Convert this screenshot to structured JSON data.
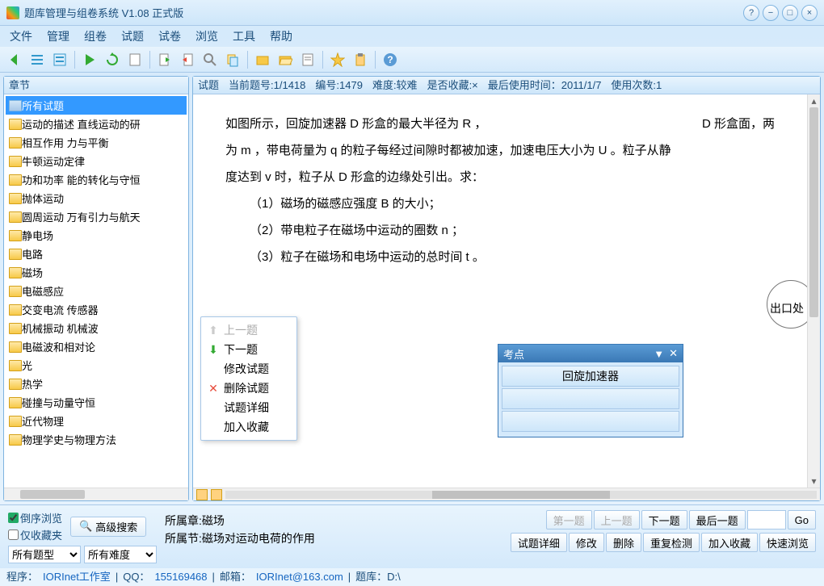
{
  "title": "题库管理与组卷系统 V1.08 正式版",
  "menu": [
    "文件",
    "管理",
    "组卷",
    "试题",
    "试卷",
    "浏览",
    "工具",
    "帮助"
  ],
  "sidebar": {
    "head": "章节",
    "items": [
      {
        "label": "所有试题",
        "root": true,
        "sel": true
      },
      {
        "label": "运动的描述 直线运动的研"
      },
      {
        "label": "相互作用 力与平衡"
      },
      {
        "label": "牛顿运动定律"
      },
      {
        "label": "功和功率 能的转化与守恒"
      },
      {
        "label": "抛体运动"
      },
      {
        "label": "圆周运动 万有引力与航天"
      },
      {
        "label": "静电场"
      },
      {
        "label": "电路"
      },
      {
        "label": "磁场"
      },
      {
        "label": "电磁感应"
      },
      {
        "label": "交变电流 传感器"
      },
      {
        "label": "机械振动 机械波"
      },
      {
        "label": "电磁波和相对论"
      },
      {
        "label": "光"
      },
      {
        "label": "热学"
      },
      {
        "label": "碰撞与动量守恒"
      },
      {
        "label": "近代物理"
      },
      {
        "label": "物理学史与物理方法"
      }
    ]
  },
  "info": {
    "head": "试题",
    "cur": "当前题号:1/1418",
    "no": "编号:1479",
    "diff": "难度:较难",
    "fav": "是否收藏:×",
    "last": "最后使用时间：2011/1/7",
    "cnt": "使用次数:1"
  },
  "doc": {
    "l1": "如图所示，回旋加速器 D 形盒的最大半径为 R ，",
    "l1b": "D 形盒面，两",
    "l2": "为 m ，带电荷量为 q 的粒子每经过间隙时都被加速，加速电压大小为 U 。粒子从静",
    "l3": "度达到 v 时，粒子从 D 形盒的边缘处引出。求：",
    "q1": "（1）磁场的磁感应强度 B 的大小；",
    "q2": "（2）带电粒子在磁场中运动的圈数 n ；",
    "q3": "（3）粒子在磁场和电场中运动的总时间 t 。",
    "exit": "出口处"
  },
  "ctx": [
    "上一题",
    "下一题",
    "修改试题",
    "删除试题",
    "试题详细",
    "加入收藏"
  ],
  "float": {
    "title": "考点",
    "row": "回旋加速器"
  },
  "bottom": {
    "chk1": "倒序浏览",
    "chk2": "仅收藏夹",
    "adv": "高级搜索",
    "sel1": "所有题型",
    "sel2": "所有难度",
    "chap": "所属章:磁场",
    "sec": "所属节:磁场对运动电荷的作用",
    "nav": [
      "第一题",
      "上一题",
      "下一题",
      "最后一题"
    ],
    "go": "Go",
    "ops": [
      "试题详细",
      "修改",
      "删除",
      "重复检测",
      "加入收藏",
      "快速浏览"
    ]
  },
  "status": {
    "prog": "程序：",
    "progv": "IORInet工作室",
    "qq": "QQ：",
    "qqv": "155169468",
    "mail": "邮箱：",
    "mailv": "IORInet@163.com",
    "lib": "题库：D:\\"
  }
}
